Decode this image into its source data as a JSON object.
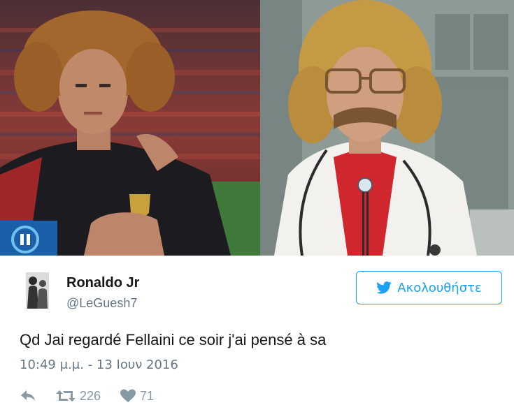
{
  "tweet": {
    "author_name": "Ronaldo Jr",
    "author_handle": "@LeGuesh7",
    "follow_label": "Ακολουθήστε",
    "text": "Qd Jai regardé Fellaini ce soir j'ai pensé à sa",
    "timestamp": "10:49 μ.μ. - 13 Ιουν 2016",
    "retweet_count": "226",
    "like_count": "71"
  },
  "icons": {
    "follow": "twitter-bird-icon",
    "reply": "reply-arrow-icon",
    "retweet": "retweet-icon",
    "like": "heart-icon",
    "pause": "pause-icon"
  },
  "colors": {
    "accent": "#1da1f2",
    "text": "#14171a",
    "muted": "#657786",
    "action": "#8899a6"
  }
}
